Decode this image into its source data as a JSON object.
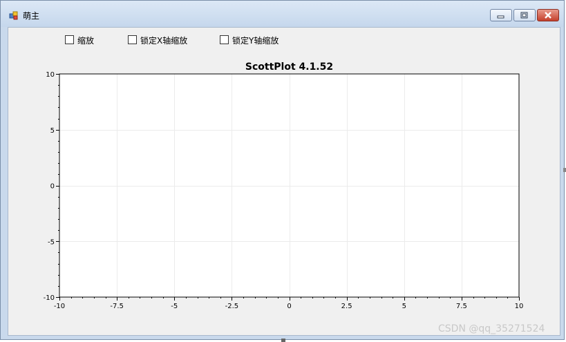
{
  "window": {
    "title": "萌主"
  },
  "checkboxes": [
    {
      "label": "缩放",
      "checked": false
    },
    {
      "label": "锁定X轴缩放",
      "checked": false
    },
    {
      "label": "锁定Y轴缩放",
      "checked": false
    }
  ],
  "chart_data": {
    "type": "line",
    "title": "ScottPlot 4.1.52",
    "xlabel": "",
    "ylabel": "",
    "xlim": [
      -10,
      10
    ],
    "ylim": [
      -10,
      10
    ],
    "x_ticks": [
      -10,
      -7.5,
      -5,
      -2.5,
      0,
      2.5,
      5,
      7.5,
      10
    ],
    "x_tick_labels": [
      "-10",
      "-7.5",
      "-5",
      "-2.5",
      "0",
      "2.5",
      "5",
      "7.5",
      "10"
    ],
    "y_ticks": [
      10,
      5,
      0,
      -5,
      -10
    ],
    "y_tick_labels": [
      "10",
      "5",
      "0",
      "-5",
      "-10"
    ],
    "grid": true,
    "series": []
  },
  "watermark": "CSDN @qq_35271524",
  "colors": {
    "grid": "#ebebeb",
    "plot_background": "#ffffff",
    "axis": "#000000"
  }
}
